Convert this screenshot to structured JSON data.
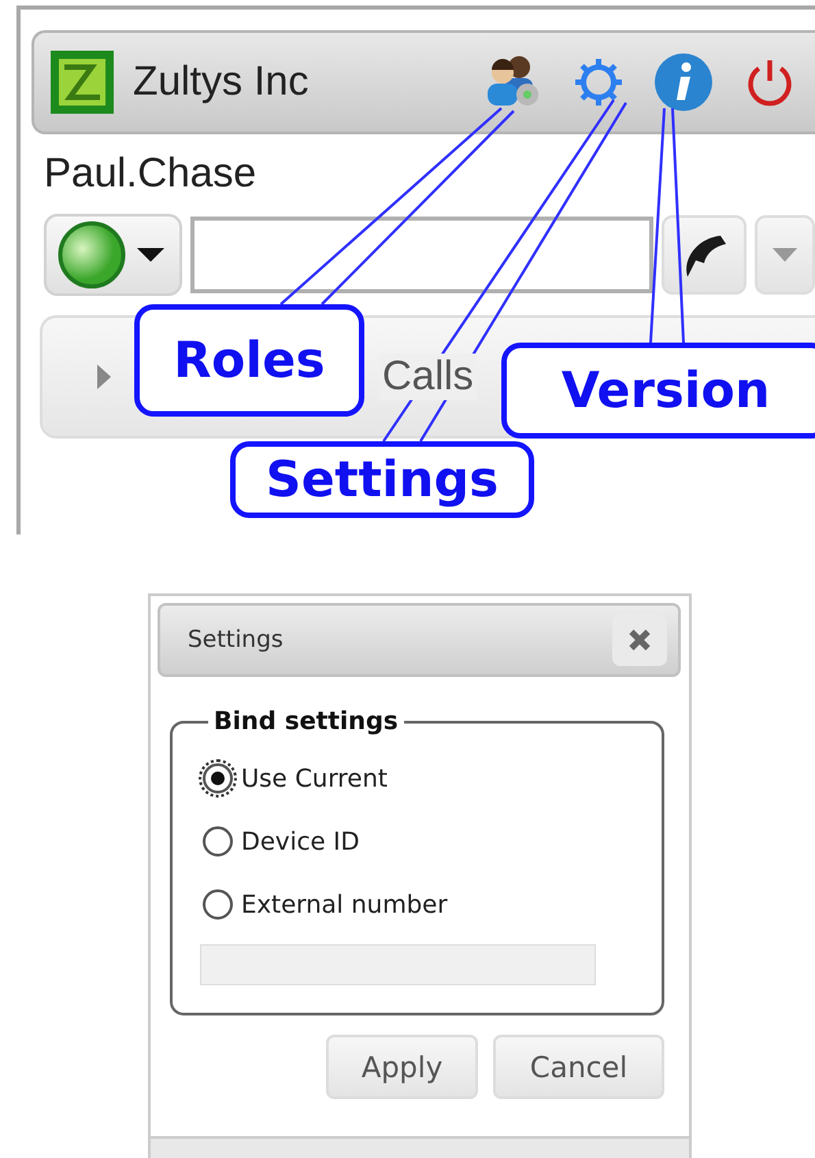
{
  "app": {
    "title": "Zultys Inc",
    "user": "Paul.Chase",
    "calls_section": {
      "label": "Calls",
      "expanded": false
    }
  },
  "callouts": [
    {
      "label": "Roles"
    },
    {
      "label": "Settings"
    },
    {
      "label": "Version"
    }
  ],
  "dialog": {
    "title": "Settings",
    "group": "Bind settings",
    "options": [
      {
        "label": "Use Current",
        "selected": true
      },
      {
        "label": "Device ID",
        "selected": false
      },
      {
        "label": "External number",
        "selected": false
      }
    ],
    "number_field": {
      "disabled": true
    },
    "buttons": [
      "Apply",
      "Cancel"
    ]
  }
}
